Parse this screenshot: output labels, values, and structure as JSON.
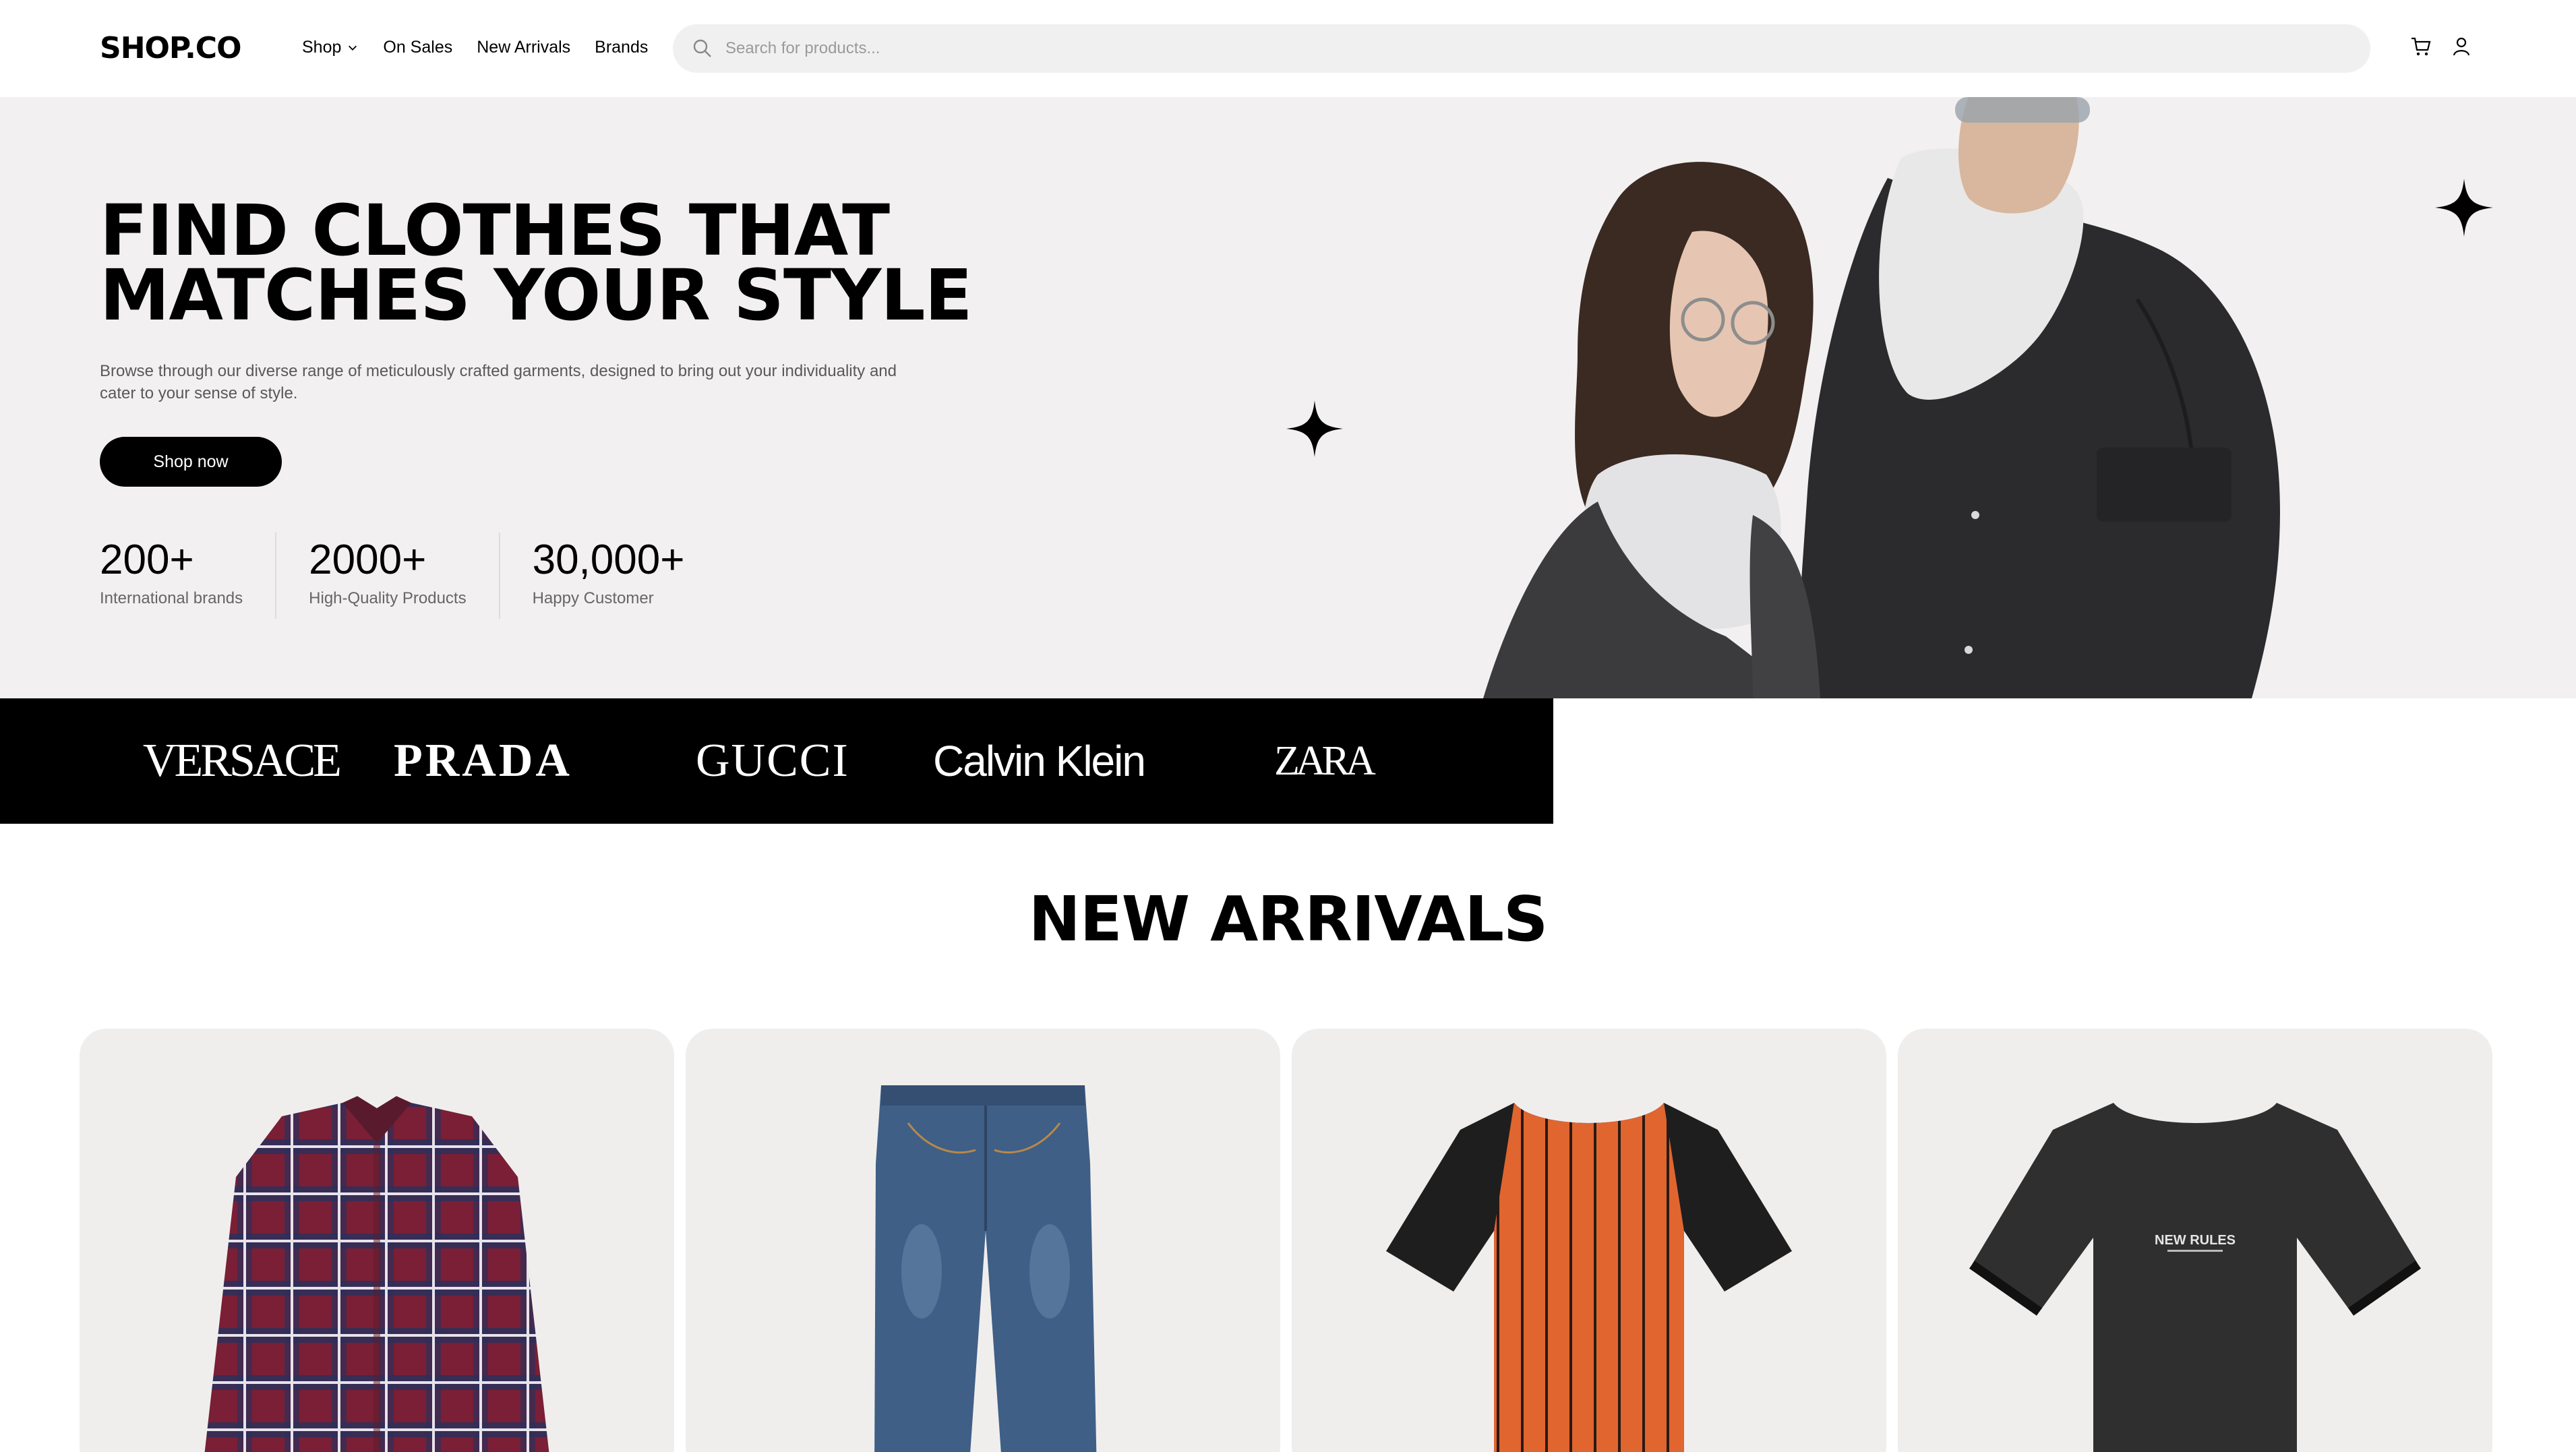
{
  "nav": {
    "logo": "SHOP.CO",
    "links": [
      "Shop",
      "On Sales",
      "New Arrivals",
      "Brands"
    ],
    "search_placeholder": "Search for products..."
  },
  "hero": {
    "title_line1": "FIND CLOTHES THAT",
    "title_line2": "MATCHES YOUR STYLE",
    "description": "Browse through our diverse range of meticulously crafted garments, designed to bring out your individuality and cater to your sense of style.",
    "cta": "Shop now",
    "stats": [
      {
        "value": "200+",
        "label": "International brands"
      },
      {
        "value": "2000+",
        "label": "High-Quality Products"
      },
      {
        "value": "30,000+",
        "label": "Happy Customer"
      }
    ]
  },
  "brands": [
    "VERSACE",
    "PRADA",
    "GUCCI",
    "Calvin Klein",
    "ZARA"
  ],
  "new_arrivals": {
    "title": "NEW ARRIVALS",
    "products": [
      {
        "name": "plaid-shirt"
      },
      {
        "name": "jeans"
      },
      {
        "name": "striped-tshirt"
      },
      {
        "name": "black-tshirt",
        "print": "NEW RULES"
      }
    ]
  },
  "colors": {
    "accent": "#000000",
    "hero_bg": "#f2f0f1",
    "card_bg": "#f0eeed"
  }
}
